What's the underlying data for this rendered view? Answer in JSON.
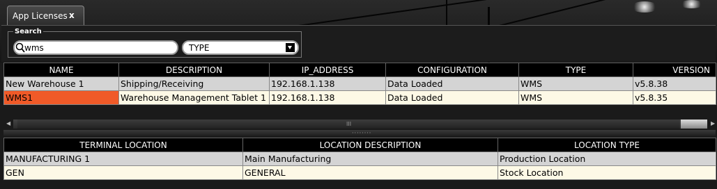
{
  "tab": {
    "label": "App Licenses",
    "close": "x"
  },
  "search": {
    "legend": "Search",
    "value": "wms",
    "type_value": "TYPE"
  },
  "licenses": {
    "columns": [
      "NAME",
      "DESCRIPTION",
      "IP_ADDRESS",
      "CONFIGURATION",
      "TYPE",
      "VERSION"
    ],
    "rows": [
      [
        "New Warehouse 1",
        "Shipping/Receiving",
        "192.168.1.138",
        "Data Loaded",
        "WMS",
        "v5.8.38"
      ],
      [
        "WMS1",
        "Warehouse Management Tablet 1",
        "192.168.1.138",
        "Data Loaded",
        "WMS",
        "v5.8.35"
      ]
    ]
  },
  "scrollbar": {
    "grip": "III"
  },
  "splitter": {
    "grip": "········"
  },
  "locations": {
    "columns": [
      "TERMINAL LOCATION",
      "LOCATION DESCRIPTION",
      "LOCATION TYPE"
    ],
    "rows": [
      [
        "MANUFACTURING 1",
        "Main Manufacturing",
        "Production Location"
      ],
      [
        "GEN",
        "GENERAL",
        "Stock Location"
      ]
    ]
  },
  "colors": {
    "selected_cell": "#f05a28",
    "row_alt": "#fdf9e6",
    "row": "#d4d4d4",
    "header": "#000000"
  }
}
